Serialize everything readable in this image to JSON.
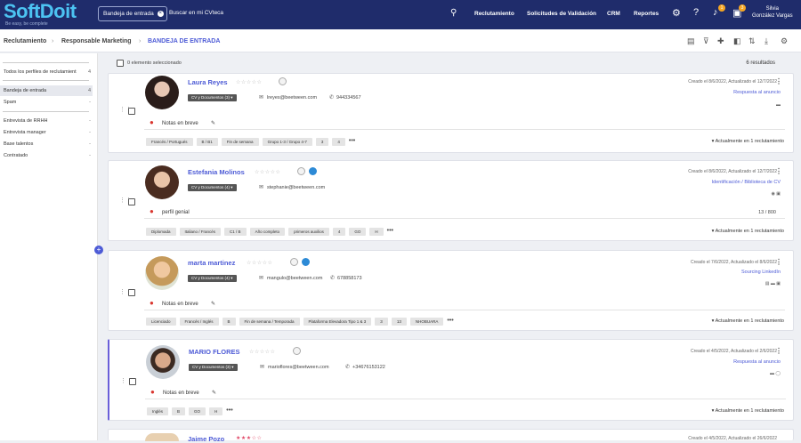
{
  "header": {
    "logo": "SoftDoit",
    "logo_tagline": "Be easy, be complete",
    "inbox_chip": "Bandeja de entrada",
    "search_placeholder": "Buscar en mi CVteca",
    "nav": [
      "Reclutamiento",
      "Solicitudes de Validación",
      "CRM",
      "Reportes"
    ],
    "badges": [
      "1",
      "3"
    ],
    "user_first": "Silvia",
    "user_last": "González Vargas"
  },
  "breadcrumb": [
    "Reclutamiento",
    "Responsable Marketing",
    "BANDEJA DE ENTRADA"
  ],
  "sidebar": {
    "items": [
      {
        "label": "Todos los perfiles de reclutamient",
        "count": "4"
      },
      {
        "label": "Bandeja de entrada",
        "count": "4",
        "selected": true
      },
      {
        "label": "Spam",
        "count": "-"
      },
      {
        "label": "Entrevista de RRHH",
        "count": "-"
      },
      {
        "label": "Entrevista manager",
        "count": "-"
      },
      {
        "label": "Base talentos",
        "count": "-"
      },
      {
        "label": "Contratado",
        "count": "-"
      }
    ]
  },
  "list": {
    "selected_text": "0 elemento seleccionado",
    "results": "6 resultados"
  },
  "candidates": [
    {
      "name": "Laura Reyes",
      "cv": "CV y Documentos",
      "cv_count": "(3)",
      "email": "lreyes@beetween.com",
      "phone": "944334567",
      "created": "Creado el 8/6/2022, Actualizado el 12/7/2022",
      "source": "Respuesta al anuncio",
      "note": "Notas en breve",
      "tags": [
        "Francés / Portugués",
        "B / B1",
        "Fin de semana",
        "Grupo 1-3 / Grupo 4-7",
        "3",
        "4"
      ],
      "updated": "Actualmente en 1 reclutamiento"
    },
    {
      "name": "Estefania Molinos",
      "cv": "CV y Documentos",
      "cv_count": "(4)",
      "email": "stephanie@beetween.com",
      "phone": "",
      "created": "Creado el 8/6/2022, Actualizado el 12/7/2022",
      "source": "Identificación / Biblioteca de CV",
      "note": "perfil genial",
      "counter": "13 / 800",
      "tags": [
        "Diplomada",
        "Italiano / Francés",
        "C1 / B",
        "Año completo",
        "primeros auxilios",
        "4",
        "GO",
        "H"
      ],
      "updated": "Actualmente en 1 reclutamiento"
    },
    {
      "name": "marta martinez",
      "cv": "CV y Documentos",
      "cv_count": "(4)",
      "email": "mangulo@beetween.com",
      "phone": "678858173",
      "created": "Creado el 7/6/2022, Actualizado el 8/6/2022",
      "source": "Sourcing LinkedIn",
      "note": "Notas en breve",
      "tags": [
        "Licenciado",
        "Francés / Inglés",
        "B",
        "Fin de semana / Temporada",
        "Plataforma Elevadora Tipo 1 & 3",
        "3",
        "13",
        "NHOBUARA"
      ],
      "updated": "Actualmente en 1 reclutamiento"
    },
    {
      "name": "MARIO FLORES",
      "cv": "CV y Documentos",
      "cv_count": "(3)",
      "email": "marioflores@beetween.com",
      "phone": "+34676153122",
      "created": "Creado el 4/5/2022, Actualizado el 2/6/2022",
      "source": "Respuesta al anuncio",
      "note": "Notas en breve",
      "tags": [
        "Inglés",
        "B",
        "GO",
        "H"
      ],
      "updated": "Actualmente en 1 reclutamiento"
    },
    {
      "name": "Jaime Pozo",
      "created": "Creado el 4/5/2022, Actualizado el 26/6/2022"
    }
  ],
  "colors": {
    "header": "#1f2c6b",
    "accent": "#4d5bd6",
    "logo": "#4cc3f2",
    "mic": "#d9362f"
  }
}
